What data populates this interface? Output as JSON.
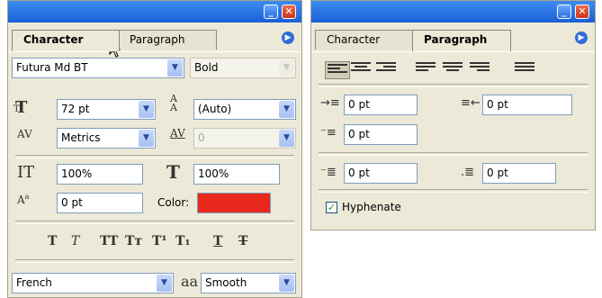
{
  "char_panel": {
    "tabs": [
      "Character",
      "Paragraph"
    ],
    "font_family": "Futura Md BT",
    "font_style": "Bold",
    "font_size": "72 pt",
    "leading": "(Auto)",
    "kerning": "Metrics",
    "tracking": "0",
    "vertical_scale": "100%",
    "horizontal_scale": "100%",
    "baseline_shift": "0 pt",
    "color_label": "Color:",
    "color_value": "#e8281c",
    "style_buttons": [
      "T",
      "T",
      "TT",
      "Tт",
      "T¹",
      "T₁",
      "T",
      "T"
    ],
    "language": "French",
    "aa_icon_text": "aa",
    "antialias": "Smooth"
  },
  "para_panel": {
    "tabs": [
      "Character",
      "Paragraph"
    ],
    "indent_left": "0 pt",
    "indent_right": "0 pt",
    "indent_first": "0 pt",
    "space_before": "0 pt",
    "space_after": "0 pt",
    "hyphenate_label": "Hyphenate",
    "hyphenate_checked": true
  }
}
